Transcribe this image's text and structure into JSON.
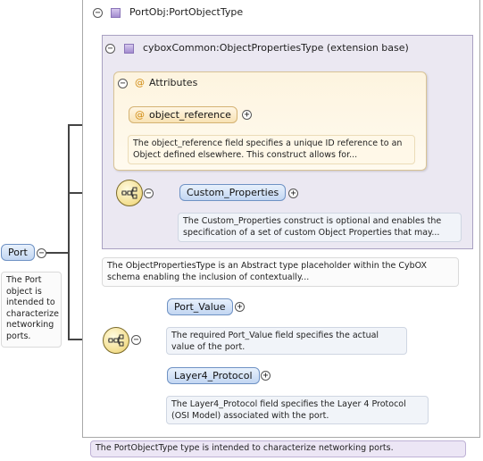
{
  "port_obj": {
    "title": "PortObj:PortObjectType",
    "doc": "The PortObjectType type is intended to characterize networking ports."
  },
  "object_properties": {
    "title": "cyboxCommon:ObjectPropertiesType (extension base)",
    "doc": "The ObjectPropertiesType is an Abstract type placeholder within the CybOX schema enabling the inclusion of contextually..."
  },
  "attributes": {
    "title": "Attributes",
    "object_reference": {
      "label": "object_reference",
      "doc": "The object_reference field specifies a unique ID reference to an Object defined elsewhere. This construct allows for..."
    }
  },
  "custom_properties": {
    "label": "Custom_Properties",
    "doc": "The Custom_Properties construct is optional and enables the specification of a set of custom Object Properties that may..."
  },
  "port": {
    "label": "Port",
    "doc": "The Port object is intended to characterize networking ports."
  },
  "port_value": {
    "label": "Port_Value",
    "doc": "The required Port_Value field specifies the actual value of the port."
  },
  "layer4_protocol": {
    "label": "Layer4_Protocol",
    "doc": "The Layer4_Protocol field specifies the Layer 4 Protocol (OSI Model) associated with the port."
  },
  "symbols": {
    "collapse": "−",
    "expand": "+",
    "attribute_marker": "@"
  }
}
